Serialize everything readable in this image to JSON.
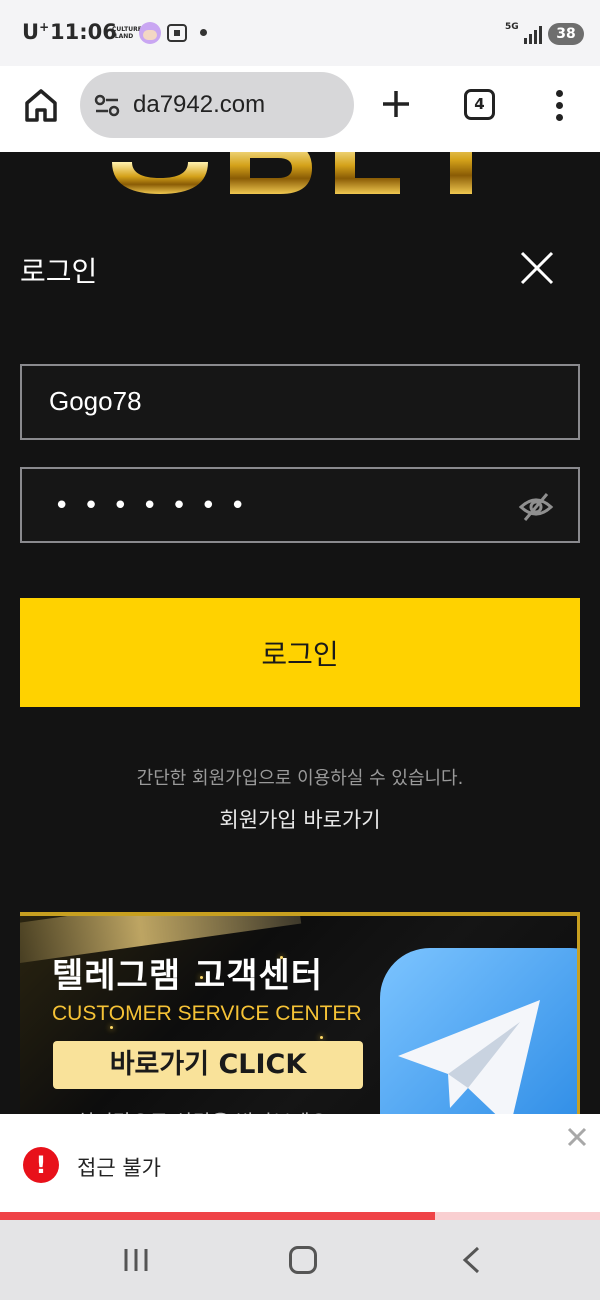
{
  "status_bar": {
    "carrier": "U",
    "carrier_sup": "+",
    "time": "11:06",
    "culture_label": "CULTURE LAND",
    "network": "5G",
    "battery": "38"
  },
  "browser": {
    "url": "da7942.com",
    "tab_count": "4"
  },
  "login": {
    "title": "로그인",
    "username_value": "Gogo78",
    "password_mask": "•••••••",
    "submit_label": "로그인",
    "signup_hint": "간단한 회원가입으로 이용하실 수 있습니다.",
    "signup_link": "회원가입 바로가기"
  },
  "banner": {
    "title": "텔레그램 고객센터",
    "subtitle": "CUSTOMER SERVICE CENTER",
    "cta": "바로가기 CLICK",
    "partial_text": "# 실시간으로 상담을 받아보세요"
  },
  "toast": {
    "message": "접근 불가",
    "progress": 0.725
  },
  "colors": {
    "accent_yellow": "#ffd200",
    "alert_red": "#e8111a",
    "progress_red": "#ef4347",
    "banner_gold": "#f5c236"
  }
}
